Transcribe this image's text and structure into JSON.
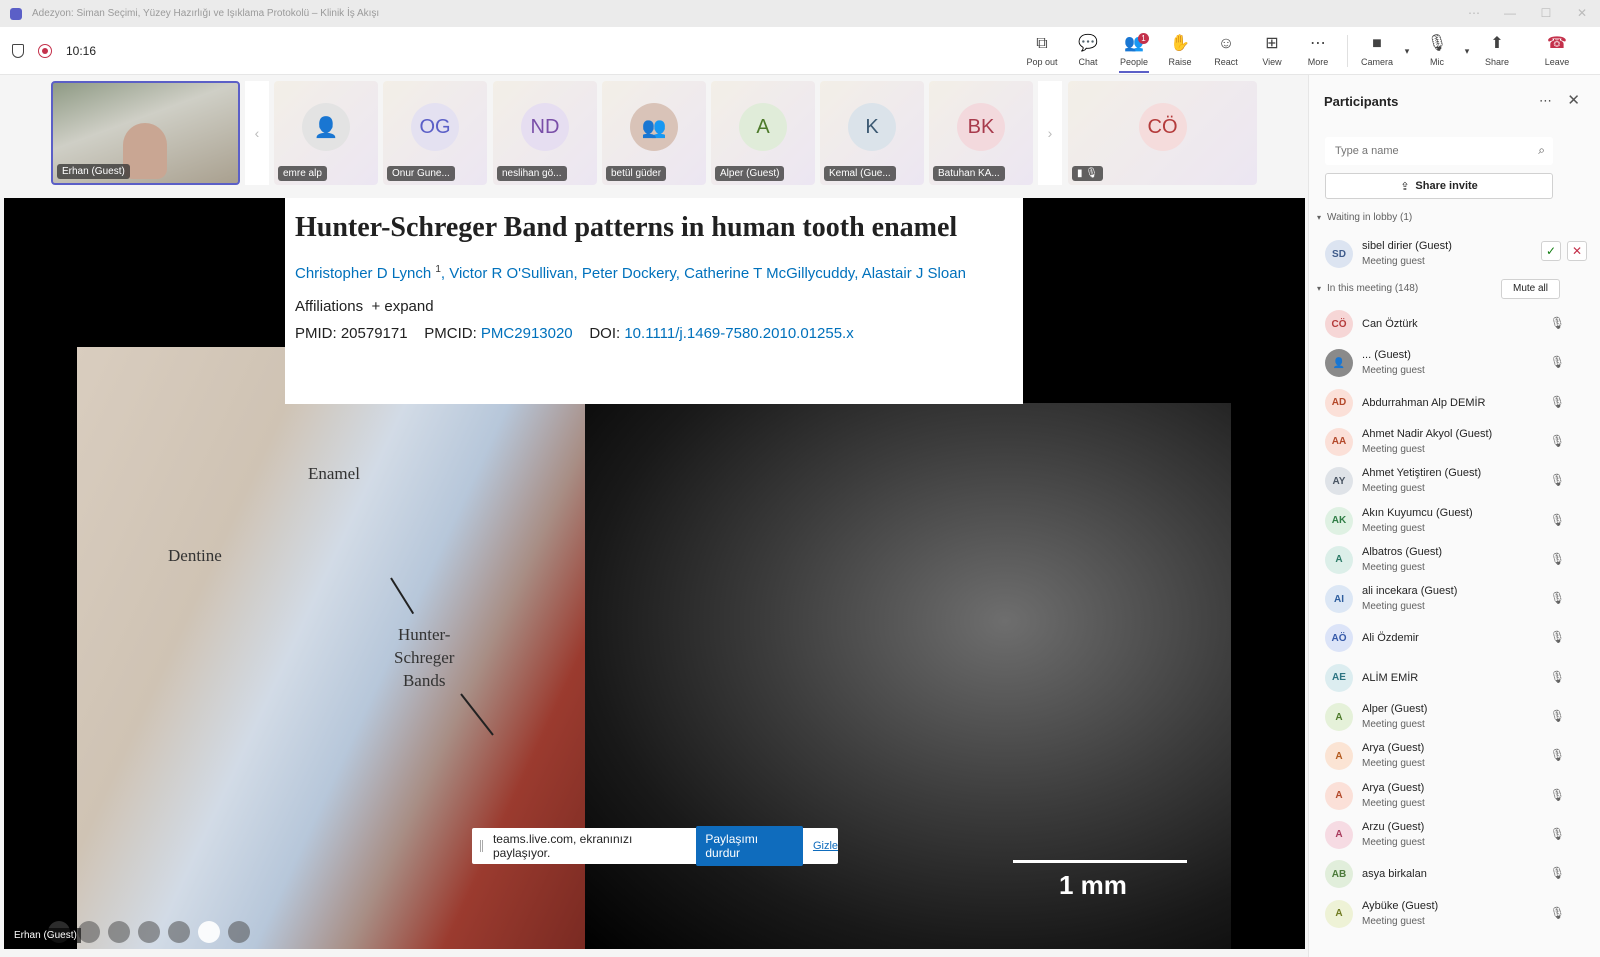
{
  "window": {
    "title": "Adezyon: Siman Seçimi, Yüzey Hazırlığı ve Işıklama Protokolü – Klinik İş Akışı",
    "controls": [
      "⋯",
      "—",
      "☐",
      "✕"
    ]
  },
  "toolbar": {
    "time": "10:16",
    "buttons": [
      {
        "label": "Pop out",
        "icon": "⧉"
      },
      {
        "label": "Chat",
        "icon": "💬"
      },
      {
        "label": "People",
        "icon": "👥",
        "badge": "1"
      },
      {
        "label": "Raise",
        "icon": "✋"
      },
      {
        "label": "React",
        "icon": "☺"
      },
      {
        "label": "View",
        "icon": "⊞"
      },
      {
        "label": "More",
        "icon": "⋯"
      }
    ],
    "camera_label": "Camera",
    "mic_label": "Mic",
    "share_label": "Share",
    "leave_label": "Leave"
  },
  "strip": {
    "tiles": [
      {
        "name": "Erhan (Guest)"
      },
      {
        "name": "emre alp"
      },
      {
        "name": "Onur Gune...",
        "initials": "OG"
      },
      {
        "name": "neslihan gö...",
        "initials": "ND"
      },
      {
        "name": "betül güder"
      },
      {
        "name": "Alper (Guest)",
        "initials": "A"
      },
      {
        "name": "Kemal (Gue...",
        "initials": "K"
      },
      {
        "name": "Batuhan KA...",
        "initials": "BK"
      },
      {
        "initials": "CÖ"
      }
    ]
  },
  "stage": {
    "paper_title": "Hunter-Schreger Band patterns in human tooth enamel",
    "authors": "Christopher D Lynch",
    "authors_sup": "1",
    "authors_rest": ", Victor R O'Sullivan, Peter Dockery, Catherine T McGillycuddy, Alastair J Sloan",
    "affiliations": "Affiliations",
    "expand": "+ expand",
    "pmid_label": "PMID: 20579171",
    "pmcid_label": "PMCID:",
    "pmcid_value": "PMC2913020",
    "doi_label": "DOI:",
    "doi_value": "10.1111/j.1469-7580.2010.01255.x",
    "label_enamel": "Enamel",
    "label_dentine": "Dentine",
    "label_hsb": "Hunter-\nSchreger\nBands",
    "scale_text": "1 mm",
    "share_text": "teams.live.com, ekranınızı paylaşıyor.",
    "stop_share": "Paylaşımı durdur",
    "hide": "Gizle",
    "presenter": "Erhan (Guest)"
  },
  "panel": {
    "title": "Participants",
    "search_placeholder": "Type a name",
    "share_invite": "Share invite",
    "lobby_header": "Waiting in lobby (1)",
    "meeting_header": "In this meeting (148)",
    "mute_all": "Mute all",
    "lobby": {
      "initials": "SD",
      "name": "sibel dirier (Guest)",
      "sub": "Meeting guest"
    },
    "people": [
      {
        "initials": "CÖ",
        "name": "Can Öztürk",
        "sub": "",
        "color": "#f6d6d6",
        "fg": "#b43b3b"
      },
      {
        "initials": "",
        "name": "... (Guest)",
        "sub": "Meeting guest",
        "color": "#8a8a8a",
        "fg": "#ffffff"
      },
      {
        "initials": "AD",
        "name": "Abdurrahman Alp DEMİR",
        "sub": "",
        "color": "#fbe0d8",
        "fg": "#b3482a"
      },
      {
        "initials": "AA",
        "name": "Ahmet Nadir Akyol (Guest)",
        "sub": "Meeting guest",
        "color": "#fbe0d8",
        "fg": "#b3482a"
      },
      {
        "initials": "AY",
        "name": "Ahmet Yetiştiren (Guest)",
        "sub": "Meeting guest",
        "color": "#dfe3e8",
        "fg": "#4a5563"
      },
      {
        "initials": "AK",
        "name": "Akın Kuyumcu (Guest)",
        "sub": "Meeting guest",
        "color": "#dff1e3",
        "fg": "#2f7d45"
      },
      {
        "initials": "A",
        "name": "Albatros (Guest)",
        "sub": "Meeting guest",
        "color": "#dcefe9",
        "fg": "#2b7a66"
      },
      {
        "initials": "AI",
        "name": "ali incekara (Guest)",
        "sub": "Meeting guest",
        "color": "#dce7f5",
        "fg": "#2e5e9e"
      },
      {
        "initials": "AÖ",
        "name": "Ali Özdemir",
        "sub": "",
        "color": "#dce4f8",
        "fg": "#3559a8"
      },
      {
        "initials": "AE",
        "name": "ALİM EMİR",
        "sub": "",
        "color": "#dcedf0",
        "fg": "#2d7482"
      },
      {
        "initials": "A",
        "name": "Alper (Guest)",
        "sub": "Meeting guest",
        "color": "#e5f1d9",
        "fg": "#4d7a2a"
      },
      {
        "initials": "A",
        "name": "Arya (Guest)",
        "sub": "Meeting guest",
        "color": "#fbe4d4",
        "fg": "#b45a1e"
      },
      {
        "initials": "A",
        "name": "Arya (Guest)",
        "sub": "Meeting guest",
        "color": "#fbe0d8",
        "fg": "#b3482a"
      },
      {
        "initials": "A",
        "name": "Arzu (Guest)",
        "sub": "Meeting guest",
        "color": "#f6dbe3",
        "fg": "#a83a5c"
      },
      {
        "initials": "AB",
        "name": "asya birkalan",
        "sub": "",
        "color": "#e1eedb",
        "fg": "#4b7a3a"
      },
      {
        "initials": "A",
        "name": "Aybüke (Guest)",
        "sub": "Meeting guest",
        "color": "#eef2d6",
        "fg": "#6f7a1f"
      }
    ]
  }
}
